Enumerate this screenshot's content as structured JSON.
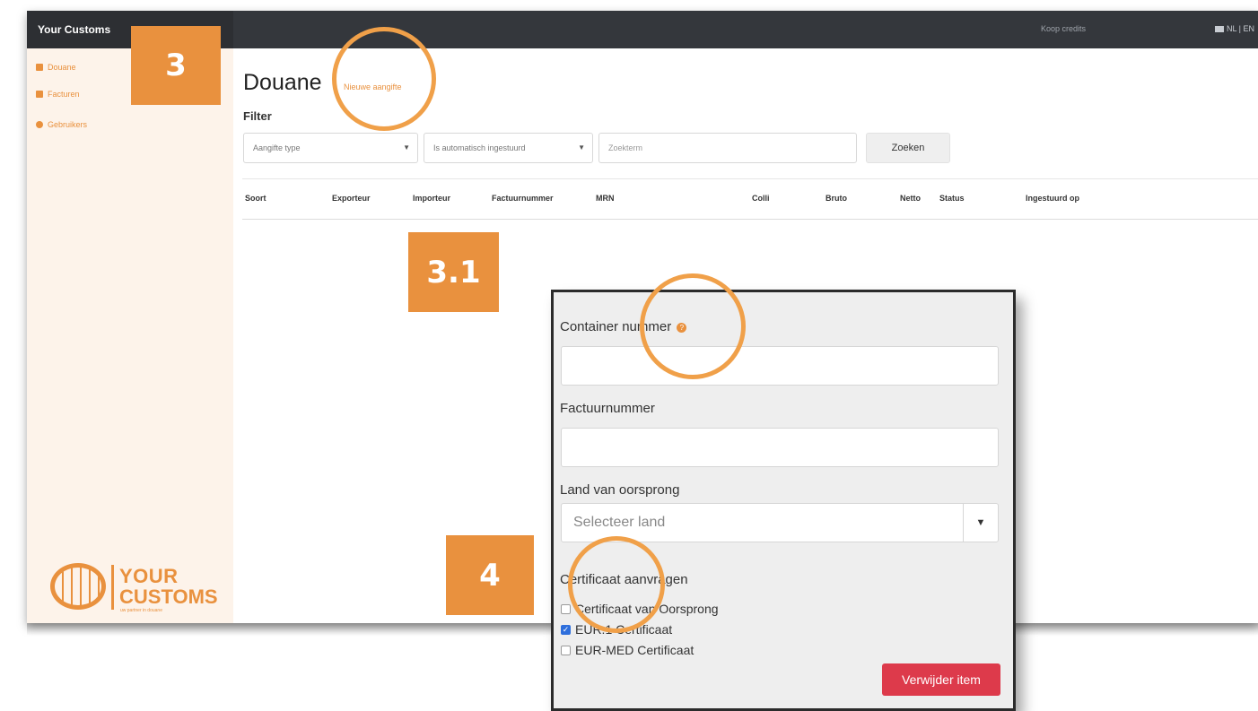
{
  "app": {
    "brand": "Your Customs",
    "buy_credits": "Koop credits",
    "language": "NL | EN"
  },
  "sidebar": {
    "items": [
      {
        "label": "Douane",
        "icon": "document-icon"
      },
      {
        "label": "Facturen",
        "icon": "document-icon"
      },
      {
        "label": "Gebruikers",
        "icon": "users-icon"
      }
    ],
    "logo": {
      "line1": "YOUR",
      "line2": "CUSTOMS",
      "tagline": "uw partner in douane"
    }
  },
  "main": {
    "title": "Douane",
    "new_link": "Nieuwe aangifte",
    "filter_label": "Filter",
    "filters": {
      "type_select": "Aangifte type",
      "auto_select": "Is automatisch ingestuurd",
      "search_placeholder": "Zoekterm",
      "search_button": "Zoeken"
    },
    "table_headers": [
      "Soort",
      "Exporteur",
      "Importeur",
      "Factuurnummer",
      "MRN",
      "Colli",
      "Bruto",
      "Netto",
      "Status",
      "Ingestuurd op"
    ]
  },
  "badges": {
    "b1": "3",
    "b2": "3.1",
    "b3": "4"
  },
  "panel": {
    "container_label": "Container nummer",
    "invoice_label": "Factuurnummer",
    "country_label": "Land van oorsprong",
    "country_placeholder": "Selecteer land",
    "certificate_label": "Certificaat aanvragen",
    "certificates": [
      {
        "label": "Certificaat van Oorsprong",
        "checked": false
      },
      {
        "label": "EUR.1 Certificaat",
        "checked": true
      },
      {
        "label": "EUR-MED Certificaat",
        "checked": false
      }
    ],
    "remove_button": "Verwijder item"
  },
  "colors": {
    "accent": "#e9913e",
    "danger": "#dd3a4b",
    "topbar": "#34373c",
    "check": "#2f6fdc"
  }
}
